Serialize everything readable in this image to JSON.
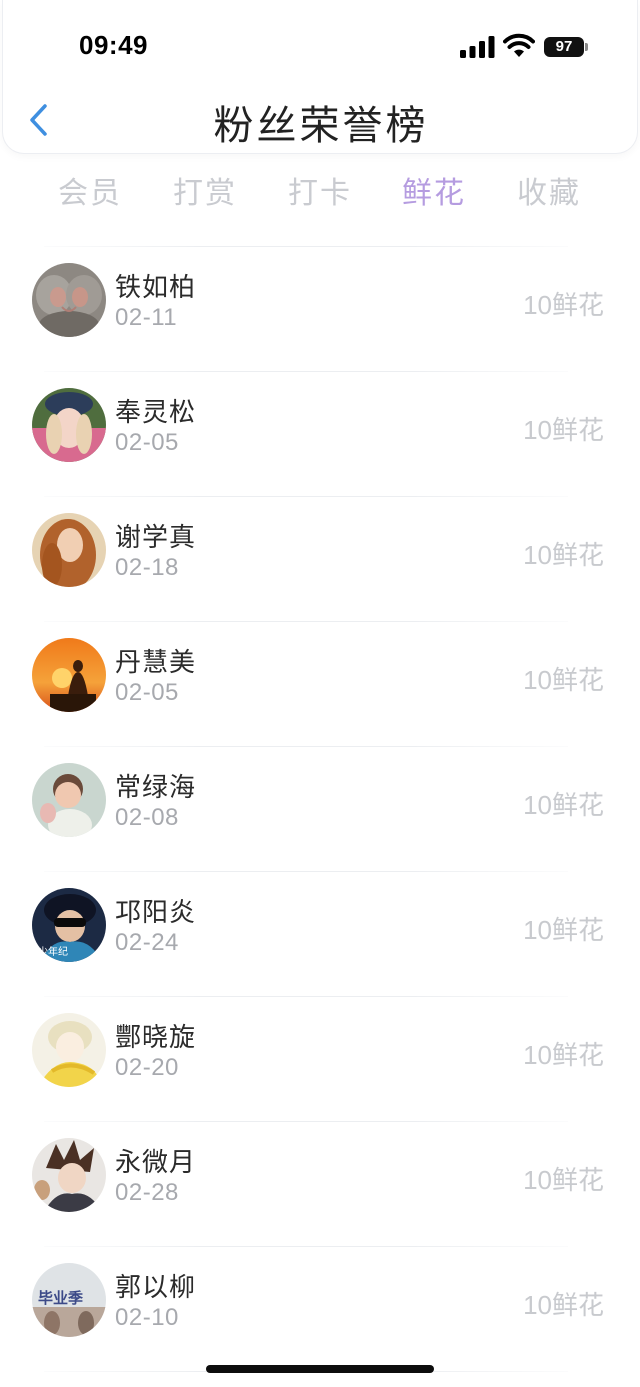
{
  "status_bar": {
    "time": "09:49",
    "battery": "97"
  },
  "header": {
    "title": "粉丝荣誉榜"
  },
  "tabs": [
    {
      "label": "会员",
      "active": false
    },
    {
      "label": "打赏",
      "active": false
    },
    {
      "label": "打卡",
      "active": false
    },
    {
      "label": "鲜花",
      "active": true
    },
    {
      "label": "收藏",
      "active": false
    }
  ],
  "unit": "鲜花",
  "fans": [
    {
      "name": "铁如柏",
      "date": "02-11",
      "count": "10",
      "avatar": "monkeys-heart-avatar"
    },
    {
      "name": "奉灵松",
      "date": "02-05",
      "count": "10",
      "avatar": "girl-cap-avatar"
    },
    {
      "name": "谢学真",
      "date": "02-18",
      "count": "10",
      "avatar": "red-hair-woman-avatar"
    },
    {
      "name": "丹慧美",
      "date": "02-05",
      "count": "10",
      "avatar": "buddha-sunset-avatar"
    },
    {
      "name": "常绿海",
      "date": "02-08",
      "count": "10",
      "avatar": "baby-avatar"
    },
    {
      "name": "邛阳炎",
      "date": "02-24",
      "count": "10",
      "avatar": "boy-sunglasses-avatar"
    },
    {
      "name": "酆晓旋",
      "date": "02-20",
      "count": "10",
      "avatar": "anime-blond-avatar"
    },
    {
      "name": "永微月",
      "date": "02-28",
      "count": "10",
      "avatar": "anime-dark-avatar"
    },
    {
      "name": "郭以柳",
      "date": "02-10",
      "count": "10",
      "avatar": "graduation-avatar"
    }
  ],
  "avatar_texts": {
    "boy": "少年纪",
    "grad": "毕业季"
  },
  "colors": {
    "active_tab": "#b59ce0",
    "inactive_tab": "#c9cbd0",
    "back_arrow": "#3f8fe0",
    "count_text": "#c8cace"
  }
}
